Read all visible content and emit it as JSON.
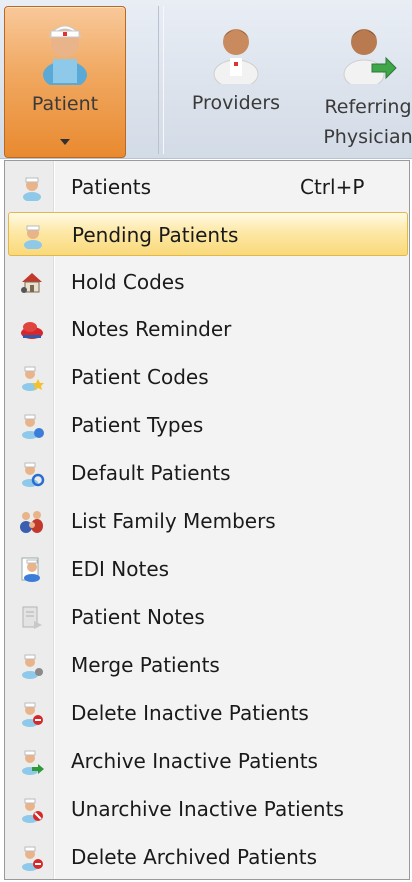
{
  "ribbon": {
    "patient_label": "Patient",
    "providers_label": "Providers",
    "referring_line1": "Referring",
    "referring_line2": "Physician"
  },
  "menu": {
    "items": [
      {
        "label": "Patients",
        "shortcut": "Ctrl+P",
        "icon": "patient-icon"
      },
      {
        "label": "Pending Patients",
        "icon": "pending-patient-icon",
        "highlighted": true
      },
      {
        "label": "Hold Codes",
        "icon": "hold-codes-icon"
      },
      {
        "label": "Notes Reminder",
        "icon": "notes-reminder-icon"
      },
      {
        "label": "Patient Codes",
        "icon": "patient-codes-icon"
      },
      {
        "label": "Patient Types",
        "icon": "patient-types-icon"
      },
      {
        "label": "Default Patients",
        "icon": "default-patients-icon"
      },
      {
        "label": "List Family Members",
        "icon": "family-members-icon"
      },
      {
        "label": "EDI Notes",
        "icon": "edi-notes-icon"
      },
      {
        "label": "Patient Notes",
        "icon": "patient-notes-icon"
      },
      {
        "label": "Merge Patients",
        "icon": "merge-patients-icon"
      },
      {
        "label": "Delete Inactive Patients",
        "icon": "delete-inactive-icon"
      },
      {
        "label": "Archive Inactive Patients",
        "icon": "archive-inactive-icon"
      },
      {
        "label": "Unarchive Inactive Patients",
        "icon": "unarchive-inactive-icon"
      },
      {
        "label": "Delete Archived Patients",
        "icon": "delete-archived-icon"
      }
    ]
  },
  "colors": {
    "active_button": "#f0a860",
    "highlight": "#fde8a6",
    "menu_bg": "#f3f3f3"
  }
}
